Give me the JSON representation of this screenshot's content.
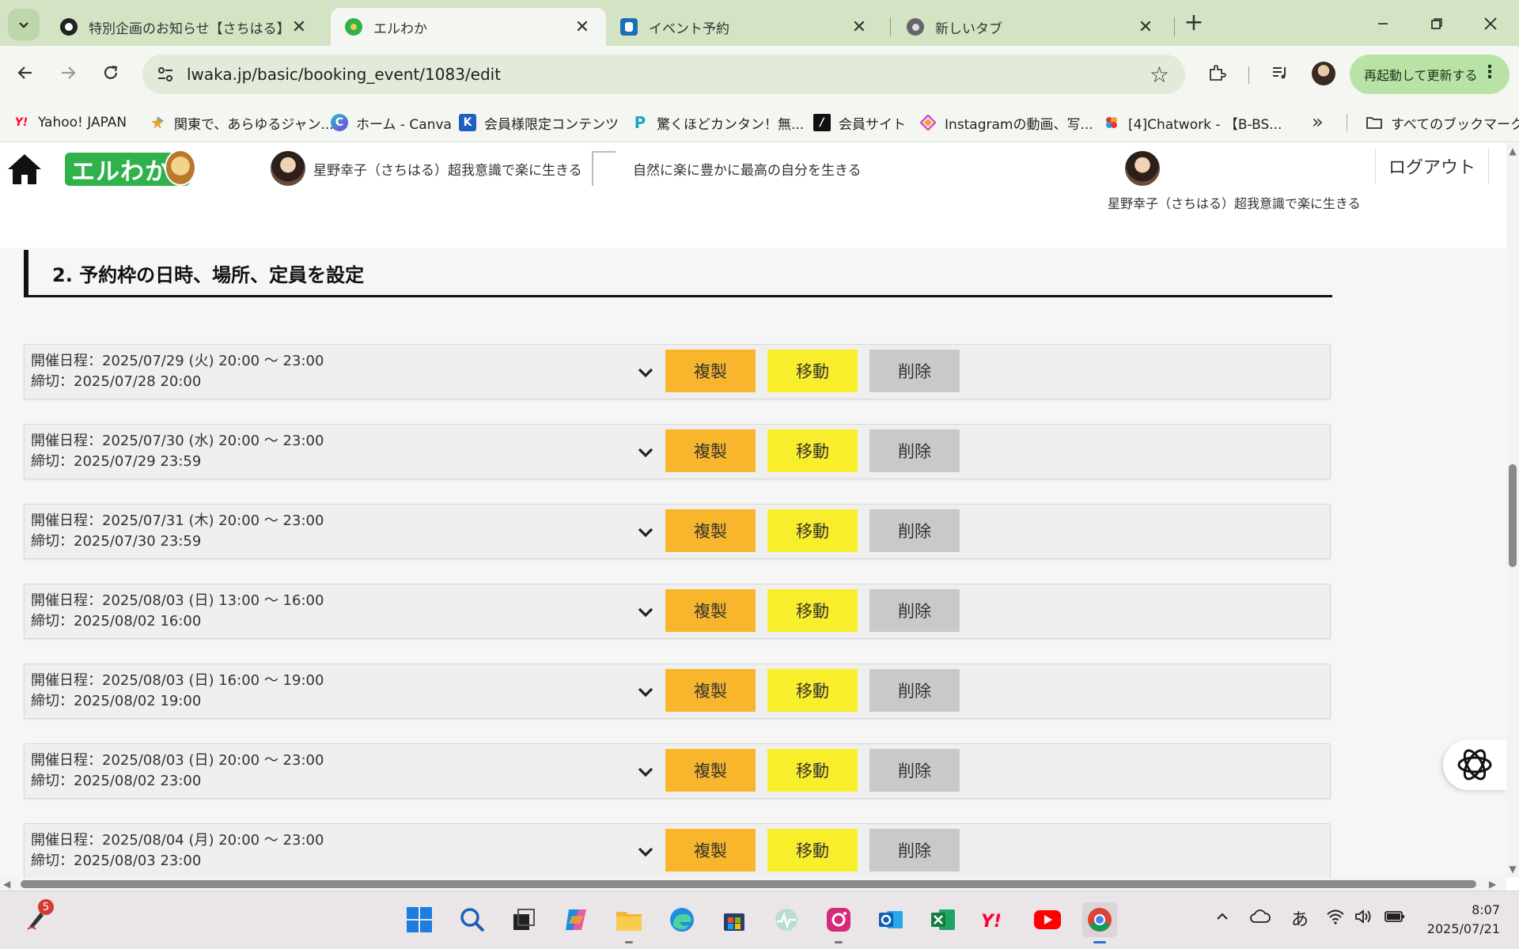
{
  "browser": {
    "tabs": [
      {
        "title": "特別企画のお知らせ【さちはる】",
        "active": false
      },
      {
        "title": "エルわか",
        "active": true
      },
      {
        "title": "イベント予約",
        "active": false
      },
      {
        "title": "新しいタブ",
        "active": false
      }
    ],
    "url": "lwaka.jp/basic/booking_event/1083/edit",
    "relaunch_label": "再起動して更新する",
    "bookmarks": [
      "Yahoo! JAPAN",
      "関東で、あらゆるジャン...",
      "ホーム - Canva",
      "会員様限定コンテンツ",
      "驚くほどカンタン！無...",
      "会員サイト",
      "Instagramの動画、写...",
      "[4]Chatwork - 【B-BS..."
    ],
    "all_bookmarks_label": "すべてのブックマーク"
  },
  "site": {
    "logo_text": "エルわか",
    "header_link1": "星野幸子（さちはる）超我意識で楽に生きる",
    "header_link2": "自然に楽に豊かに最高の自分を生きる",
    "header_name2": "星野幸子（さちはる）超我意識で楽に生きる",
    "logout_label": "ログアウト",
    "section_title": "2. 予約枠の日時、場所、定員を設定"
  },
  "slot_buttons": {
    "copy": "複製",
    "move": "移動",
    "delete": "削除"
  },
  "slots": [
    {
      "date": "開催日程：2025/07/29 (火) 20:00 ～ 23:00",
      "deadline": "締切：2025/07/28 20:00"
    },
    {
      "date": "開催日程：2025/07/30 (水) 20:00 ～ 23:00",
      "deadline": "締切：2025/07/29 23:59"
    },
    {
      "date": "開催日程：2025/07/31 (木) 20:00 ～ 23:00",
      "deadline": "締切：2025/07/30 23:59"
    },
    {
      "date": "開催日程：2025/08/03 (日) 13:00 ～ 16:00",
      "deadline": "締切：2025/08/02 16:00"
    },
    {
      "date": "開催日程：2025/08/03 (日) 16:00 ～ 19:00",
      "deadline": "締切：2025/08/02 19:00"
    },
    {
      "date": "開催日程：2025/08/03 (日) 20:00 ～ 23:00",
      "deadline": "締切：2025/08/02 23:00"
    },
    {
      "date": "開催日程：2025/08/04 (月) 20:00 ～ 23:00",
      "deadline": "締切：2025/08/03 23:00"
    }
  ],
  "taskbar": {
    "notification_count": "5",
    "ime_label": "あ",
    "time": "8:07",
    "date": "2025/07/21"
  },
  "colors": {
    "copy_button": "#f7b62b",
    "move_button": "#f8ee2c",
    "delete_button": "#c9c9c9",
    "logo_green": "#2fb14b",
    "tabstrip": "#d3e3c4"
  }
}
